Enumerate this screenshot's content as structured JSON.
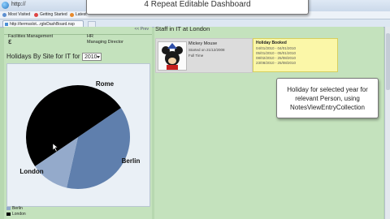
{
  "browser": {
    "address": "http://",
    "bookmarks": [
      "Most Visited",
      "Getting Started",
      "Latest"
    ],
    "tab_title": "http://termsslot...rgleDashBoard.nsp"
  },
  "overlay_title": "4 Repeat Editable Dashboard",
  "left": {
    "prev_link": "<< Prev",
    "department": "Facilities Management",
    "hr": "HR",
    "role": "Managing Director",
    "holidays_label": "Holidays By Site for IT for",
    "year": "2010"
  },
  "chart_data": {
    "type": "pie",
    "title": "",
    "slices": [
      {
        "name": "Rome",
        "value": 38,
        "color": "#5f7fad"
      },
      {
        "name": "Berlin",
        "value": 12,
        "color": "#94aacb"
      },
      {
        "name": "London",
        "value": 50,
        "color": "#000000"
      }
    ]
  },
  "legend": [
    "Berlin",
    "London"
  ],
  "right": {
    "staff_header": "Staff in IT at London",
    "person": {
      "name": "Mickey Mouse",
      "started": "Started on 21/12/2008",
      "type": "Full Time"
    },
    "holiday_title": "Holiday Booked",
    "holidays": [
      "04/01/2010 - 04/01/2010",
      "05/01/2010 - 05/01/2010",
      "08/02/2010 - 25/08/2010",
      "23/08/2010 - 25/08/2010"
    ],
    "callout": "Holiday for selected year for relevant Person, using NotesViewEntryCollection"
  }
}
